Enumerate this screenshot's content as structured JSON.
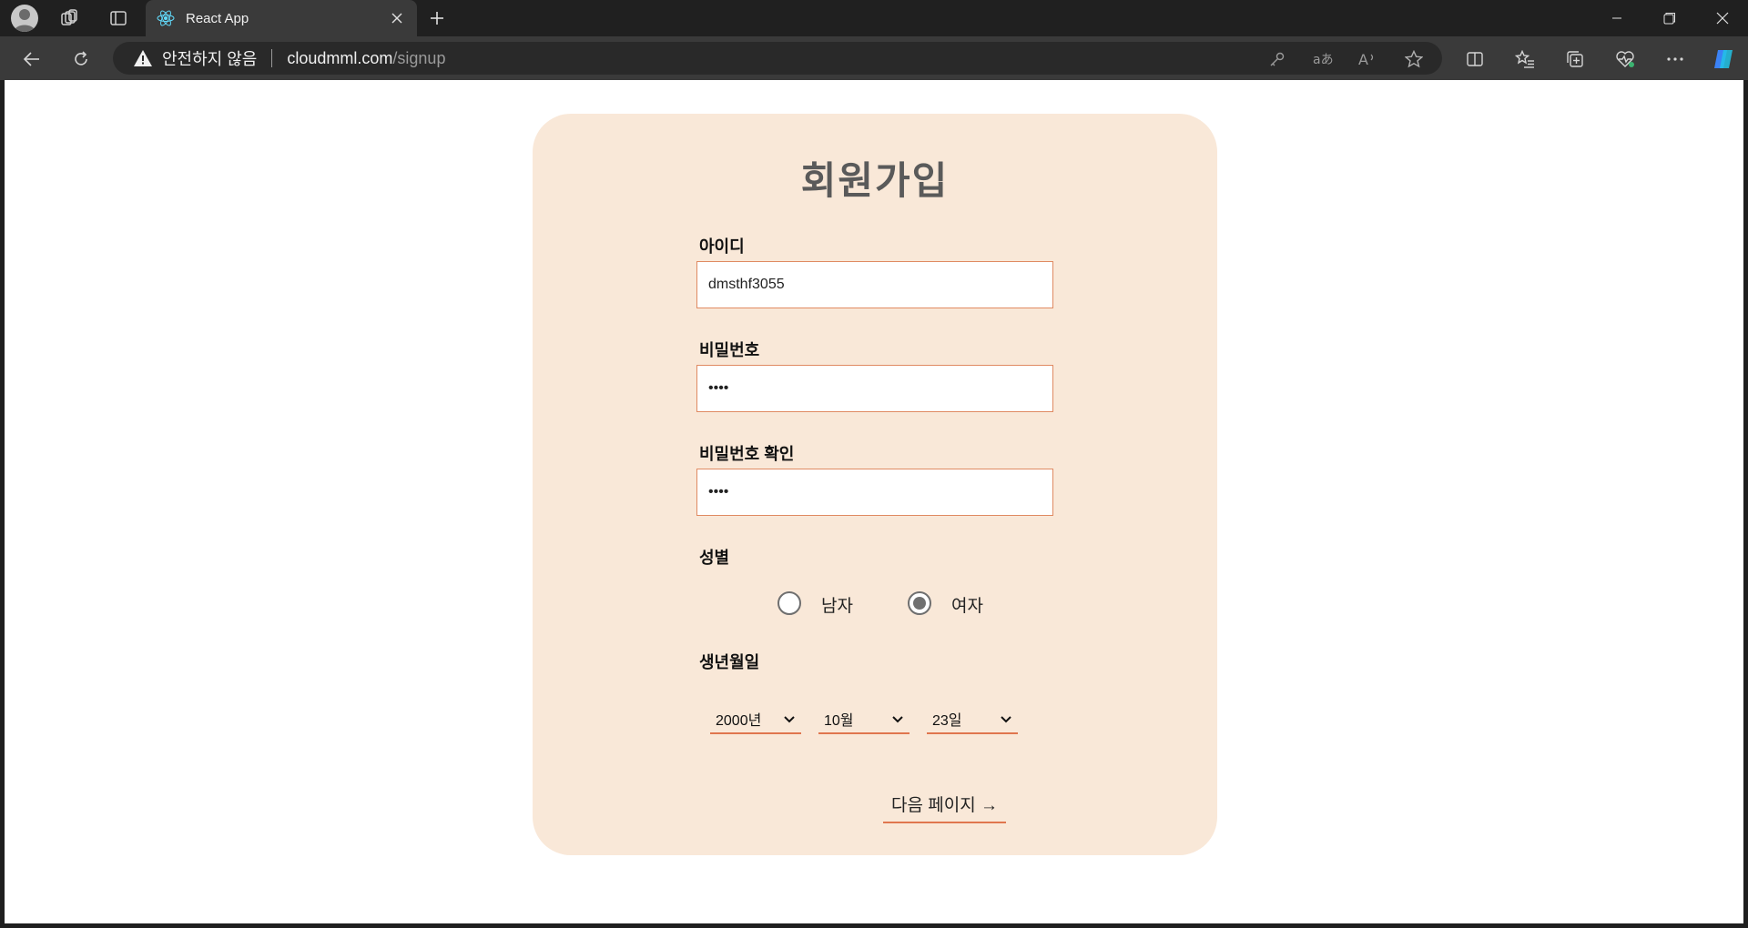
{
  "browser": {
    "tab_title": "React App",
    "security_label": "안전하지 않음",
    "url_host": "cloudmml.com",
    "url_path": "/signup"
  },
  "form": {
    "title": "회원가입",
    "id_label": "아이디",
    "id_value": "dmsthf3055",
    "password_label": "비밀번호",
    "password_value": "••••",
    "password_confirm_label": "비밀번호 확인",
    "password_confirm_value": "••••",
    "gender_label": "성별",
    "gender_options": [
      {
        "label": "남자",
        "selected": false
      },
      {
        "label": "여자",
        "selected": true
      }
    ],
    "birth_label": "생년월일",
    "birth_year": "2000년",
    "birth_month": "10월",
    "birth_day": "23일",
    "next_label": "다음 페이지 →"
  },
  "colors": {
    "card_bg": "#f9e8d8",
    "accent": "#e0764e",
    "title_text": "#5a5a5a"
  }
}
